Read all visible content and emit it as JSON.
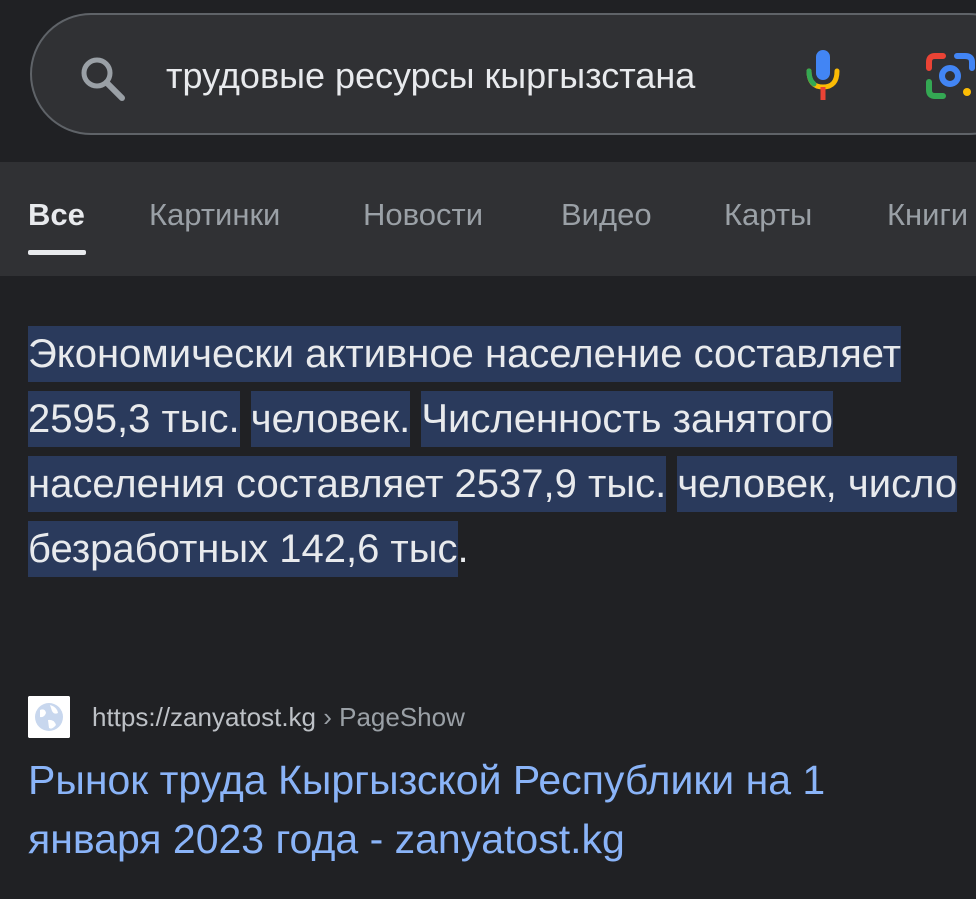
{
  "search": {
    "query": "трудовые ресурсы кыргызстана"
  },
  "icons": {
    "search": "search-icon",
    "mic": "mic-icon",
    "lens": "lens-icon",
    "favicon": "globe-icon"
  },
  "colors": {
    "link": "#8ab4f8",
    "highlight": "#2a3a5c",
    "background": "#202124"
  },
  "tabs": [
    {
      "label": "Все",
      "active": true
    },
    {
      "label": "Картинки",
      "active": false
    },
    {
      "label": "Новости",
      "active": false
    },
    {
      "label": "Видео",
      "active": false
    },
    {
      "label": "Карты",
      "active": false
    },
    {
      "label": "Книги",
      "active": false
    }
  ],
  "featured_snippet": {
    "seg1": "Экономически активное население составляет 2595,3 тыс.",
    "seg2": "человек.",
    "seg3": "Численность занятого населения составляет 2537,9 тыс.",
    "seg4": "человек, число безработных 142,6 тыс",
    "seg5": "."
  },
  "result": {
    "url": "https://zanyatost.kg",
    "path": " › PageShow",
    "title": "Рынок труда Кыргызской Республики на 1 января 2023 года - zanyatost.kg"
  }
}
